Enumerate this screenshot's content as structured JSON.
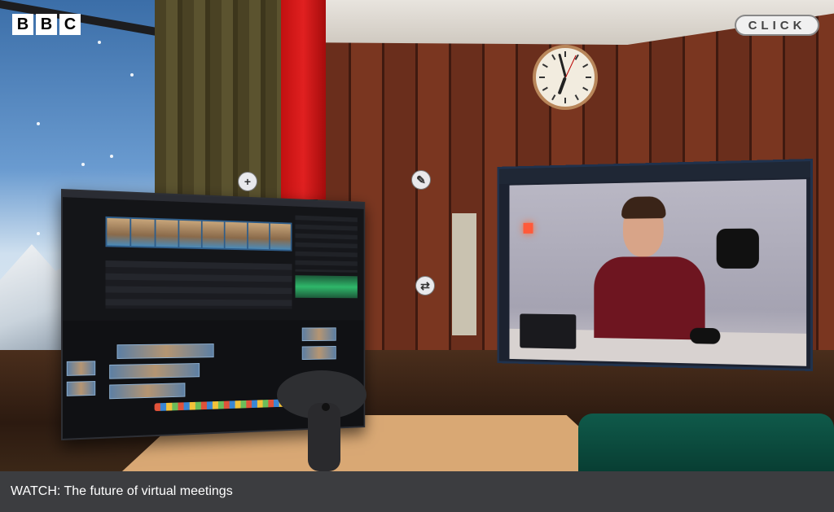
{
  "branding": {
    "bbc_letters": [
      "B",
      "B",
      "C"
    ],
    "click_label": "CLICK"
  },
  "caption": {
    "text": "WATCH: The future of virtual meetings"
  },
  "controls": {
    "add_icon": "plus-icon",
    "edit_icon": "pencil-icon",
    "swap_icon": "swap-icon"
  },
  "colors": {
    "caption_bg": "#3c3d40",
    "curtain_red": "#e02020",
    "wall_wood": "#6a2e1c"
  }
}
